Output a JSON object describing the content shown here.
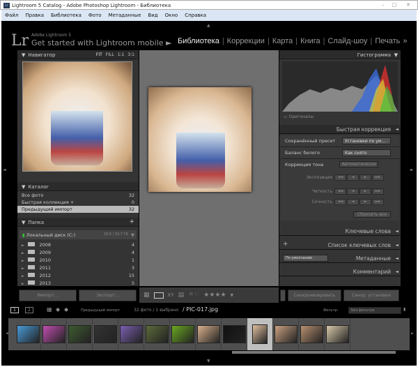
{
  "window": {
    "title": "Lightroom 5 Catalog - Adobe Photoshop Lightroom - Библиотека",
    "icon": "Lr"
  },
  "menu": [
    "Файл",
    "Правка",
    "Библиотека",
    "Фото",
    "Метаданные",
    "Вид",
    "Окно",
    "Справка"
  ],
  "identity": {
    "logo": "Lr",
    "product": "Adobe Lightroom 5",
    "promo": "Get started with Lightroom mobile ►"
  },
  "modules": [
    "Библиотека",
    "Коррекции",
    "Карта",
    "Книга",
    "Слайд-шоу",
    "Печать"
  ],
  "modules_more": "»",
  "navigator": {
    "title": "Навигатор",
    "zoom": [
      "FIT",
      "FILL",
      "1:1",
      "3:1"
    ]
  },
  "catalog": {
    "title": "Каталог",
    "items": [
      {
        "label": "Все фото",
        "count": "32"
      },
      {
        "label": "Быстрая коллекция +",
        "count": "0"
      },
      {
        "label": "Предыдущий импорт",
        "count": "32"
      }
    ]
  },
  "folders": {
    "title": "Папка",
    "add": "+",
    "disk": "Локальный диск (C:)",
    "disk_size": "18.6 / 50.7 ГБ",
    "items": [
      {
        "label": "2008",
        "count": "4"
      },
      {
        "label": "2009",
        "count": "4"
      },
      {
        "label": "2010",
        "count": "1"
      },
      {
        "label": "2011",
        "count": "3"
      },
      {
        "label": "2012",
        "count": "15"
      },
      {
        "label": "2013",
        "count": "5"
      }
    ]
  },
  "left_buttons": {
    "import": "Импорт...",
    "export": "Экспорт..."
  },
  "histogram": {
    "title": "Гистограмма",
    "originals": "Оригиналы"
  },
  "quick_develop": {
    "title": "Быстрая коррекция",
    "preset_label": "Сохранённый пресет",
    "preset_value": "Установки по ум...",
    "wb_label": "Баланс белого",
    "wb_value": "Как снято",
    "tone_label": "Коррекция тона",
    "auto": "Автоматически",
    "exposure": "Экспозиция",
    "clarity": "Четкость",
    "vibrance": "Сочность",
    "step_labels": [
      "◄◄",
      "◄",
      "►",
      "►►"
    ],
    "reset": "Сбросить все"
  },
  "right_panels": {
    "keywords": "Ключевые слова",
    "keyword_list": "Список ключевых слов",
    "metadata_preset": "По умолчанию",
    "metadata": "Метаданные",
    "comments": "Комментарий"
  },
  "right_buttons": {
    "sync": "Синхронизировать",
    "sync_settings": "Синхр. установки"
  },
  "toolbar": {
    "stars": "★★★★"
  },
  "filmstrip": {
    "views": [
      "1",
      "2"
    ],
    "source": "Предыдущий импорт",
    "count": "32 фото / 1 выбрано",
    "file": "/ PIC-017.jpg",
    "filter_label": "Фильтр:",
    "filter_value": "Без фильтра",
    "thumbs": [
      "#4a9bd8",
      "#c04fb0",
      "#3d5a30",
      "#333",
      "#7a5fb0",
      "#5c6a3a",
      "#6aa820",
      "#d9b08c",
      "#111",
      "#e0c0a0",
      "#c9a080",
      "#b89070",
      "#d8c8a8"
    ]
  }
}
